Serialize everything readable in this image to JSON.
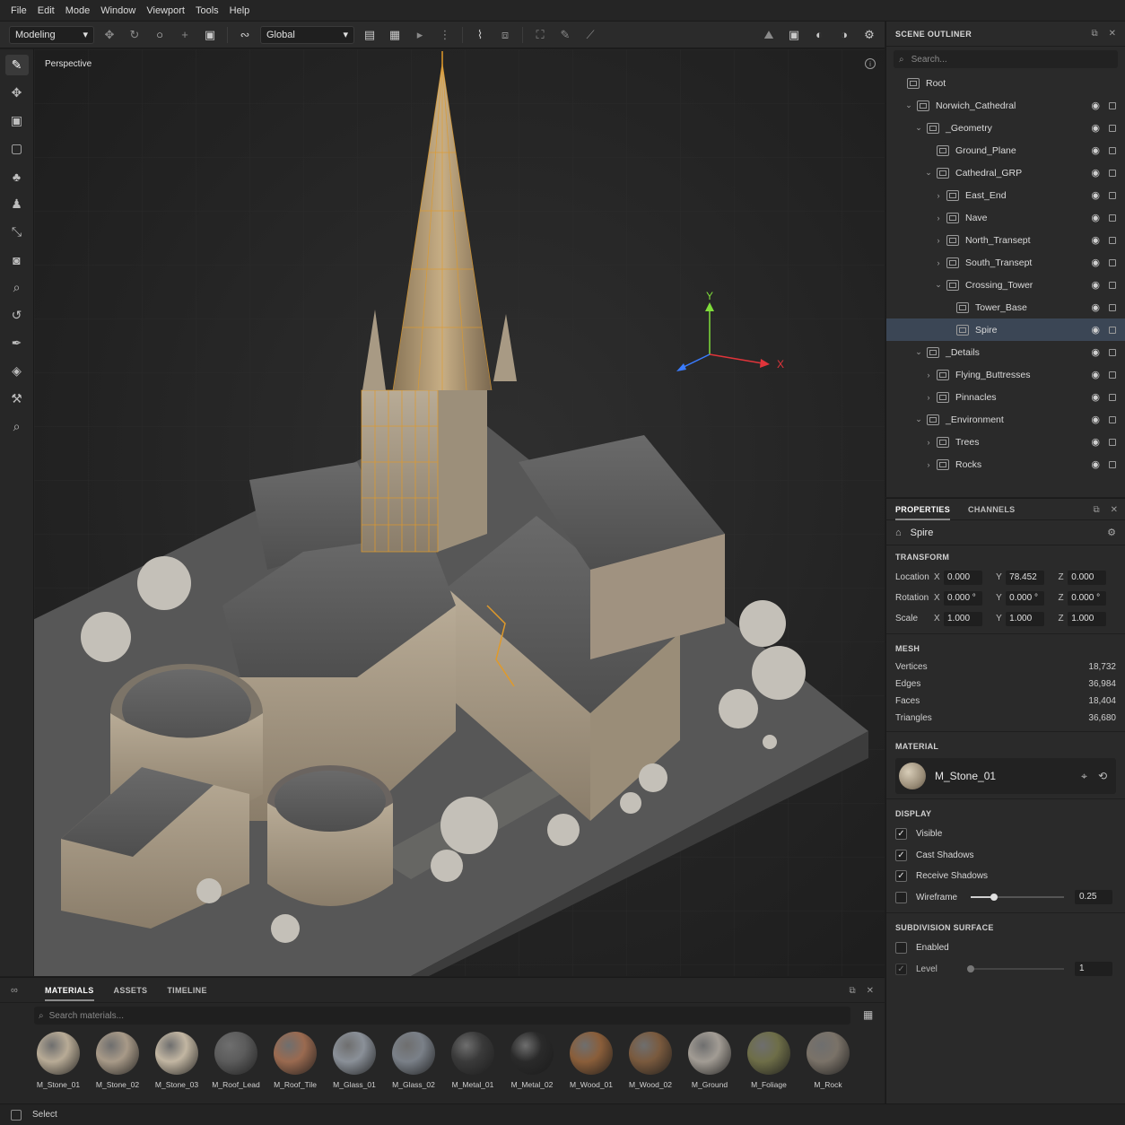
{
  "menu": [
    "File",
    "Edit",
    "Mode",
    "Window",
    "Viewport",
    "Tools",
    "Help"
  ],
  "toolbar": {
    "mode": "Modeling",
    "space": "Global"
  },
  "viewport": {
    "label": "Perspective",
    "gizmo": {
      "x": "X",
      "y": "Y"
    }
  },
  "outliner": {
    "title": "SCENE OUTLINER",
    "search_placeholder": "Search...",
    "items": [
      {
        "label": "Root",
        "depth": 0,
        "chev": "",
        "selected": false
      },
      {
        "label": "Norwich_Cathedral",
        "depth": 1,
        "chev": "v",
        "selected": false
      },
      {
        "label": "_Geometry",
        "depth": 2,
        "chev": "v",
        "selected": false
      },
      {
        "label": "Ground_Plane",
        "depth": 3,
        "chev": "",
        "selected": false
      },
      {
        "label": "Cathedral_GRP",
        "depth": 3,
        "chev": "v",
        "selected": false
      },
      {
        "label": "East_End",
        "depth": 4,
        "chev": ">",
        "selected": false
      },
      {
        "label": "Nave",
        "depth": 4,
        "chev": ">",
        "selected": false
      },
      {
        "label": "North_Transept",
        "depth": 4,
        "chev": ">",
        "selected": false
      },
      {
        "label": "South_Transept",
        "depth": 4,
        "chev": ">",
        "selected": false
      },
      {
        "label": "Crossing_Tower",
        "depth": 4,
        "chev": "v",
        "selected": false
      },
      {
        "label": "Tower_Base",
        "depth": 5,
        "chev": "",
        "selected": false
      },
      {
        "label": "Spire",
        "depth": 5,
        "chev": "",
        "selected": true
      },
      {
        "label": "_Details",
        "depth": 2,
        "chev": "v",
        "selected": false
      },
      {
        "label": "Flying_Buttresses",
        "depth": 3,
        "chev": ">",
        "selected": false
      },
      {
        "label": "Pinnacles",
        "depth": 3,
        "chev": ">",
        "selected": false
      },
      {
        "label": "_Environment",
        "depth": 2,
        "chev": "v",
        "selected": false
      },
      {
        "label": "Trees",
        "depth": 3,
        "chev": ">",
        "selected": false
      },
      {
        "label": "Rocks",
        "depth": 3,
        "chev": ">",
        "selected": false
      }
    ]
  },
  "properties": {
    "tabs": [
      "PROPERTIES",
      "CHANNELS"
    ],
    "object": "Spire",
    "transform": {
      "title": "TRANSFORM",
      "rows": [
        {
          "label": "Location",
          "x": "0.000",
          "y": "78.452",
          "z": "0.000"
        },
        {
          "label": "Rotation",
          "x": "0.000 °",
          "y": "0.000 °",
          "z": "0.000 °"
        },
        {
          "label": "Scale",
          "x": "1.000",
          "y": "1.000",
          "z": "1.000"
        }
      ]
    },
    "mesh": {
      "title": "MESH",
      "stats": [
        {
          "label": "Vertices",
          "value": "18,732"
        },
        {
          "label": "Edges",
          "value": "36,984"
        },
        {
          "label": "Faces",
          "value": "18,404"
        },
        {
          "label": "Triangles",
          "value": "36,680"
        }
      ]
    },
    "material": {
      "title": "MATERIAL",
      "name": "M_Stone_01"
    },
    "display": {
      "title": "DISPLAY",
      "visible": "Visible",
      "cast": "Cast Shadows",
      "receive": "Receive Shadows",
      "wireframe": "Wireframe",
      "wireframe_value": "0.25",
      "wireframe_level": 0.25
    },
    "subdivision": {
      "title": "SUBDIVISION SURFACE",
      "enabled": "Enabled",
      "level": "Level",
      "level_value": "1"
    }
  },
  "bottom": {
    "tabs": [
      "MATERIALS",
      "ASSETS",
      "TIMELINE"
    ],
    "search_placeholder": "Search materials...",
    "materials": [
      {
        "name": "M_Stone_01",
        "color": "#b8ab96"
      },
      {
        "name": "M_Stone_02",
        "color": "#a89a88"
      },
      {
        "name": "M_Stone_03",
        "color": "#c2b6a2"
      },
      {
        "name": "M_Roof_Lead",
        "color": "#5c5c5c"
      },
      {
        "name": "M_Roof_Tile",
        "color": "#9a6a50"
      },
      {
        "name": "M_Glass_01",
        "color": "#8a9098"
      },
      {
        "name": "M_Glass_02",
        "color": "#7a8088"
      },
      {
        "name": "M_Metal_01",
        "color": "#3a3a3a"
      },
      {
        "name": "M_Metal_02",
        "color": "#2a2a2a"
      },
      {
        "name": "M_Wood_01",
        "color": "#8a5e3a"
      },
      {
        "name": "M_Wood_02",
        "color": "#7a5a3e"
      },
      {
        "name": "M_Ground",
        "color": "#a29c94"
      },
      {
        "name": "M_Foliage",
        "color": "#6e6e48"
      },
      {
        "name": "M_Rock",
        "color": "#7a7268"
      }
    ]
  },
  "status": "Select"
}
